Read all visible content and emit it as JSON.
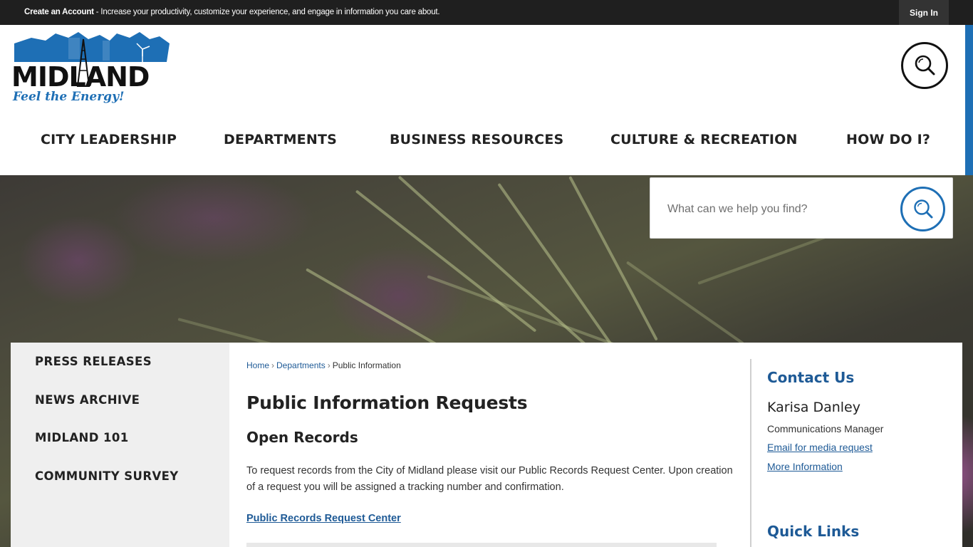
{
  "topbar": {
    "create_account": "Create an Account",
    "message": " - Increase your productivity, customize your experience, and engage in information you care about.",
    "sign_in": "Sign In"
  },
  "logo": {
    "name": "MIDLAND",
    "tagline": "Feel the Energy!",
    "brand_color": "#1e6fb5"
  },
  "nav": {
    "items": [
      {
        "label": "CITY LEADERSHIP"
      },
      {
        "label": "DEPARTMENTS"
      },
      {
        "label": "BUSINESS RESOURCES"
      },
      {
        "label": "CULTURE & RECREATION"
      },
      {
        "label": "HOW DO I?"
      }
    ]
  },
  "search": {
    "placeholder": "What can we help you find?",
    "icon": "search-icon"
  },
  "sidebar": {
    "items": [
      {
        "label": "PRESS RELEASES"
      },
      {
        "label": "NEWS ARCHIVE"
      },
      {
        "label": "MIDLAND 101"
      },
      {
        "label": "COMMUNITY SURVEY"
      }
    ]
  },
  "breadcrumb": {
    "home": "Home",
    "departments": "Departments",
    "current": "Public Information",
    "separator": "›"
  },
  "main": {
    "title": "Public Information Requests",
    "subhead": "Open Records",
    "paragraph": "To request records from the City of Midland please visit our Public Records Request Center. Upon creation of a request you will be assigned a tracking number and confirmation.",
    "link": "Public Records Request Center"
  },
  "contact": {
    "title": "Contact Us",
    "name": "Karisa Danley",
    "role": "Communications Manager",
    "email_link": "Email for media request",
    "more_link": "More Information"
  },
  "quick_links": {
    "title": "Quick Links"
  },
  "colors": {
    "accent": "#1e6fb5",
    "link": "#1e5a96",
    "topbar": "#1f1f1f"
  }
}
